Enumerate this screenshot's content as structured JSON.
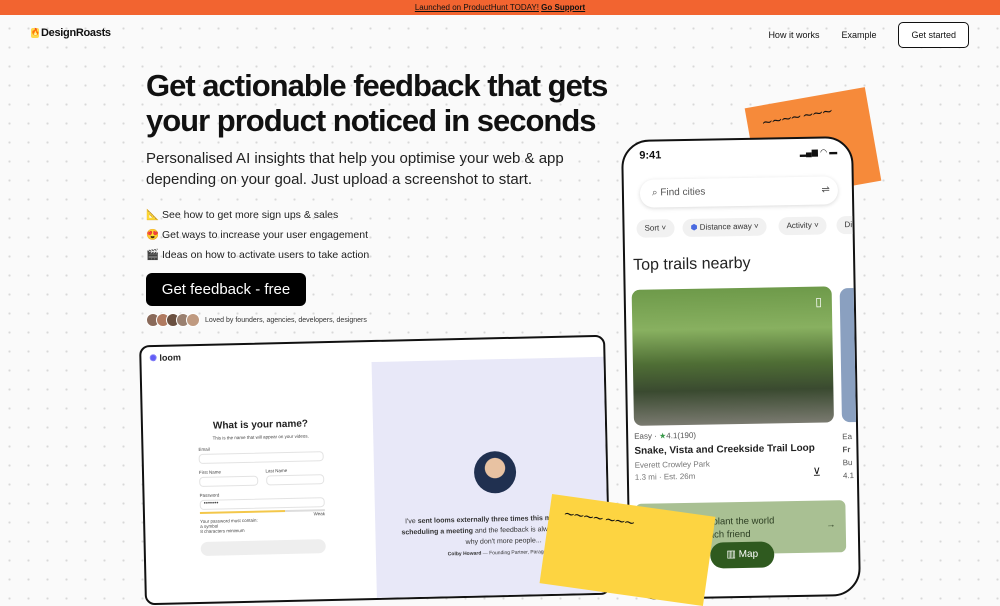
{
  "banner": {
    "text": "Launched on ProductHunt TODAY!",
    "link": "Go Support",
    "color": "#f26430"
  },
  "nav": {
    "logo": "DesignRoasts",
    "items": [
      "How it works",
      "Example"
    ],
    "cta": "Get started"
  },
  "hero": {
    "title": "Get actionable feedback that gets your product noticed in seconds",
    "subtitle": "Personalised AI insights that help you optimise your web & app depending on your goal. Just upload a screenshot to start.",
    "bullets": [
      {
        "icon": "📐",
        "text": "See how to get more sign ups & sales"
      },
      {
        "icon": "😍",
        "text": "Get ways to increase your user engagement"
      },
      {
        "icon": "🎬",
        "text": "Ideas on how to activate users to take action"
      }
    ],
    "cta": "Get feedback - free",
    "social_proof": "Loved by founders, agencies, developers, designers"
  },
  "loom_mock": {
    "brand": "loom",
    "title": "What is your name?",
    "hint": "This is the name that will appear on your videos.",
    "labels": [
      "Email",
      "First Name",
      "Last Name",
      "Password"
    ],
    "password": "•••••••",
    "strength": "Weak",
    "rules_title": "Your password must contain:",
    "rules": [
      "a symbol",
      "8 characters minimum"
    ],
    "quote_pre": "I've ",
    "quote_b1": "sent looms externally three times this month instead of scheduling a meeting",
    "quote_mid": " and the feedback is always, \"This is great, why don't more people...",
    "author": "Colby Howard",
    "author_role": " — Founding Partner, Paragon Intel"
  },
  "phone_mock": {
    "time": "9:41",
    "search_placeholder": "Find cities",
    "chips": [
      "Sort",
      "Distance away",
      "Activity",
      "Di"
    ],
    "section": "Top trails nearby",
    "card": {
      "meta": "Easy · ",
      "rating": "4.1",
      "reviews": "(190)",
      "title": "Snake, Vista and Creekside Trail Loop",
      "park": "Everett Crowley Park",
      "stats": "1.3 mi · Est. 26m"
    },
    "card2": {
      "meta": "Ea",
      "title": "Fr",
      "park": "Bu",
      "stats": "4.1"
    },
    "promo": "Let's replant the world",
    "promo2": "3 for each friend",
    "map_button": "Map"
  },
  "stickies": {
    "scribble": "~~~~ ~~~"
  }
}
